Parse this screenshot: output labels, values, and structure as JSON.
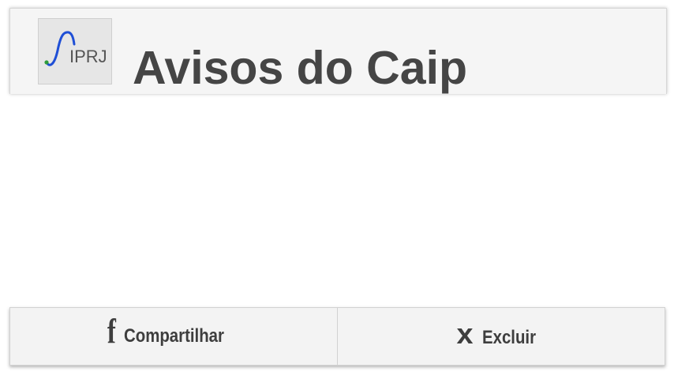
{
  "header": {
    "logo_text": "IPRJ",
    "title": "Avisos do Caip"
  },
  "actions": {
    "share": {
      "icon": "facebook-icon",
      "glyph": "f",
      "label": "Compartilhar"
    },
    "delete": {
      "icon": "close-icon",
      "glyph": "x",
      "label": "Excluir"
    }
  },
  "colors": {
    "header_bg": "#f5f5f5",
    "title_text": "#454545",
    "action_bar_bg": "#f3f3f3",
    "logo_curve": "#1f4fd6",
    "logo_dot": "#2e9b3a"
  }
}
